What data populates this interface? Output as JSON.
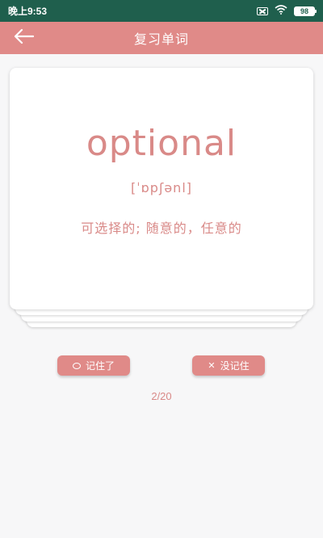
{
  "status_bar": {
    "time": "晚上9:53",
    "battery": "98",
    "icons": [
      "sim-error-icon",
      "wifi-icon",
      "battery-icon"
    ]
  },
  "header": {
    "title": "复习单词",
    "back_icon": "arrow-left-icon"
  },
  "card": {
    "word": "optional",
    "phonetic": "[ˈɒpʃənl]",
    "meaning": "可选择的; 随意的，任意的"
  },
  "actions": {
    "remember_label": "记住了",
    "remember_icon": "circle-icon",
    "forget_label": "没记住",
    "forget_icon": "x-icon"
  },
  "progress": "2/20",
  "colors": {
    "accent": "#e08a88",
    "status_bar": "#1f5f4d",
    "background": "#f7f7f8"
  }
}
